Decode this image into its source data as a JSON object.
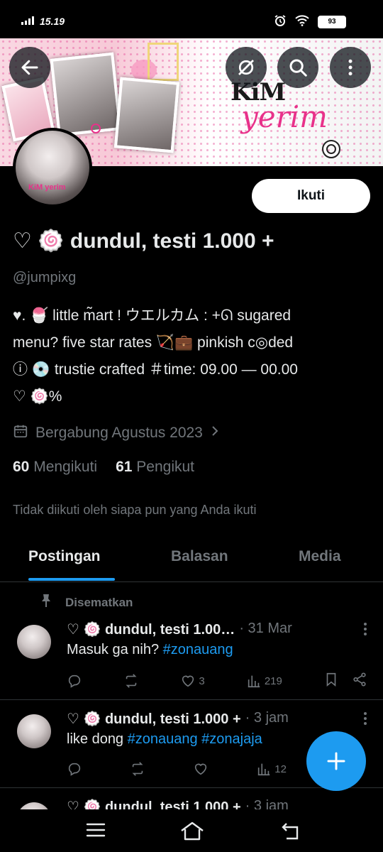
{
  "status_bar": {
    "time": "15.19",
    "battery": "93"
  },
  "banner": {
    "word1": "KiM",
    "word2": "yerim",
    "avatar_tag": "KiM yerim"
  },
  "profile": {
    "follow_label": "Ikuti",
    "name": "♡ 🍥 dundul, testi 1.000 +",
    "handle": "@jumpixg",
    "bio_lines": [
      "♥︎. 🍧 little m̃art !   ウエルカム : +ᘏ sugared",
      "menu? five star rates 🏹💼 pinkish c◎ded",
      "ⓘ 💿 trustie crafted ＃time: 09.00 — 00.00",
      "♡ 🍥%"
    ],
    "joined": "Bergabung Agustus 2023",
    "following_count": "60",
    "following_label": "Mengikuti",
    "followers_count": "61",
    "followers_label": "Pengikut",
    "not_followed_note": "Tidak diikuti oleh siapa pun yang Anda ikuti"
  },
  "tabs": [
    "Postingan",
    "Balasan",
    "Media"
  ],
  "pinned_label": "Disematkan",
  "posts": [
    {
      "name": "♡ 🍥 dundul, testi 1.00…",
      "meta": "· 31 Mar",
      "text": "Masuk ga nih? ",
      "tags": [
        "#zonauang"
      ],
      "likes": "3",
      "views": "219"
    },
    {
      "name": "♡ 🍥 dundul, testi 1.000 +",
      "meta": "· 3 jam",
      "text": "like dong ",
      "tags": [
        "#zonauang",
        "#zonajaja"
      ],
      "likes": "",
      "views": "12"
    },
    {
      "name": "♡ 🍥 dundul, testi 1.000 +",
      "meta": "· 3 jam"
    }
  ]
}
